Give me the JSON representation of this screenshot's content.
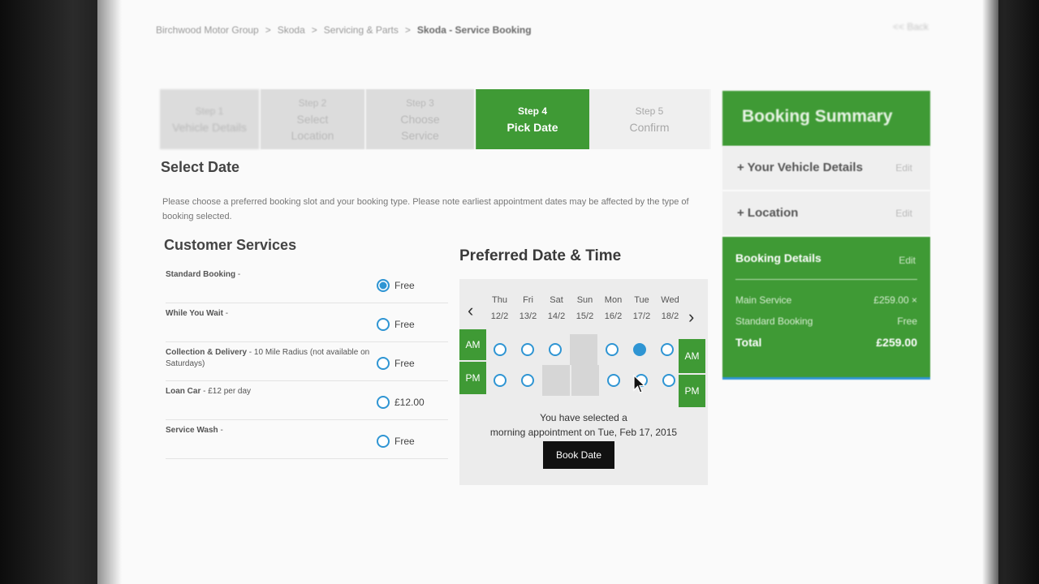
{
  "breadcrumb": {
    "items": [
      "Birchwood Motor Group",
      "Skoda",
      "Servicing & Parts"
    ],
    "separator": ">",
    "current": "Skoda - Service Booking"
  },
  "back_link": "<< Back",
  "steps": [
    {
      "num": "Step 1",
      "label": "Vehicle Details"
    },
    {
      "num": "Step 2",
      "label": "Select Location"
    },
    {
      "num": "Step 3",
      "label": "Choose Service"
    },
    {
      "num": "Step 4",
      "label": "Pick Date"
    },
    {
      "num": "Step 5",
      "label": "Confirm"
    }
  ],
  "select_date": {
    "title": "Select Date",
    "intro": "Please choose a preferred booking slot and your booking type. Please note earliest appointment dates may be affected by the type of booking selected."
  },
  "customer_services": {
    "title": "Customer Services",
    "items": [
      {
        "name": "Standard Booking",
        "suffix": " -",
        "price": "Free",
        "selected": true
      },
      {
        "name": "While You Wait",
        "suffix": " -",
        "price": "Free",
        "selected": false
      },
      {
        "name": "Collection & Delivery",
        "suffix": " - 10 Mile Radius (not available on Saturdays)",
        "price": "Free",
        "selected": false
      },
      {
        "name": "Loan Car",
        "suffix": " - £12 per day",
        "price": "£12.00",
        "selected": false
      },
      {
        "name": "Service Wash",
        "suffix": " -",
        "price": "Free",
        "selected": false
      }
    ]
  },
  "calendar": {
    "title": "Preferred Date & Time",
    "days": [
      {
        "name": "Thu",
        "date": "12/2"
      },
      {
        "name": "Fri",
        "date": "13/2"
      },
      {
        "name": "Sat",
        "date": "14/2"
      },
      {
        "name": "Sun",
        "date": "15/2"
      },
      {
        "name": "Mon",
        "date": "16/2"
      },
      {
        "name": "Tue",
        "date": "17/2"
      },
      {
        "name": "Wed",
        "date": "18/2"
      }
    ],
    "am_label": "AM",
    "pm_label": "PM",
    "am_slots": [
      "open",
      "open",
      "open",
      "closed",
      "open",
      "selected",
      "open"
    ],
    "pm_slots": [
      "open",
      "open",
      "closed",
      "closed",
      "open",
      "open",
      "open"
    ],
    "message_line1": "You have selected a",
    "message_line2": "morning appointment on Tue, Feb 17, 2015",
    "book_button": "Book Date"
  },
  "summary": {
    "title": "Booking Summary",
    "vehicle": "+ Your Vehicle Details",
    "location": "+ Location",
    "edit": "Edit",
    "details_title": "Booking Details",
    "lines": [
      {
        "label": "Main Service",
        "value": "£259.00 ×"
      },
      {
        "label": "Standard Booking",
        "value": "Free"
      }
    ],
    "total_label": "Total",
    "total_value": "£259.00"
  },
  "colors": {
    "brand_green": "#3f9a35",
    "radio_blue": "#2f95d3"
  }
}
